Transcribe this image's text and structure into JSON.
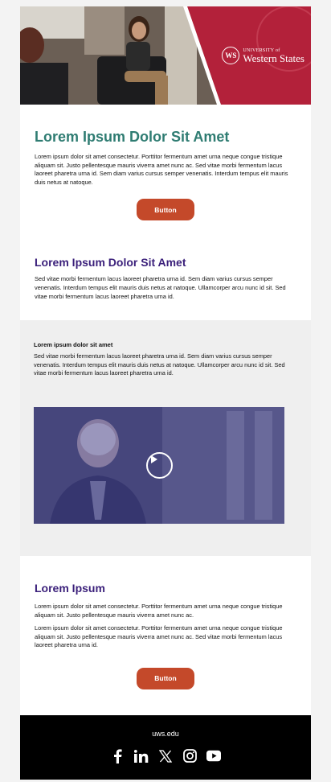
{
  "brand": {
    "name": "Western States",
    "prefix": "UNIVERSITY of",
    "monogram": "WS",
    "primary_color": "#b3213a",
    "button_color": "#c4492a"
  },
  "intro": {
    "heading": "Lorem Ipsum Dolor Sit Amet",
    "body": "Lorem ipsum dolor sit amet consectetur. Porttitor fermentum amet urna neque congue tristique aliquam sit. Justo pellentesque mauris viverra amet nunc ac. Sed vitae morbi fermentum lacus laoreet pharetra urna id. Sem diam varius cursus semper venenatis. Interdum tempus elit mauris duis netus at natoque.",
    "button": "Button"
  },
  "section2": {
    "heading": "Lorem Ipsum Dolor Sit Amet",
    "body": "Sed vitae morbi fermentum lacus laoreet pharetra urna id. Sem diam varius cursus semper venenatis. Interdum tempus elit mauris duis netus at natoque. Ullamcorper arcu nunc id sit. Sed vitae morbi fermentum lacus laoreet pharetra urna id."
  },
  "section3": {
    "heading": "Lorem ipsum dolor sit amet",
    "body": "Sed vitae morbi fermentum lacus laoreet pharetra urna id. Sem diam varius cursus semper venenatis. Interdum tempus elit mauris duis netus at natoque. Ullamcorper arcu nunc id sit. Sed vitae morbi fermentum lacus laoreet pharetra urna id.",
    "video_icon": "play-icon"
  },
  "section4": {
    "heading": "Lorem Ipsum",
    "body1": "Lorem ipsum dolor sit amet consectetur. Porttitor fermentum amet urna neque congue tristique aliquam sit. Justo pellentesque mauris viverra amet nunc ac.",
    "body2": "Lorem ipsum dolor sit amet consectetur. Porttitor fermentum amet urna neque congue tristique aliquam sit. Justo pellentesque mauris viverra amet nunc ac. Sed vitae morbi fermentum lacus laoreet pharetra urna id.",
    "button": "Button"
  },
  "footer": {
    "url": "uws.edu",
    "socials": [
      "facebook-icon",
      "linkedin-icon",
      "x-icon",
      "instagram-icon",
      "youtube-icon"
    ]
  }
}
